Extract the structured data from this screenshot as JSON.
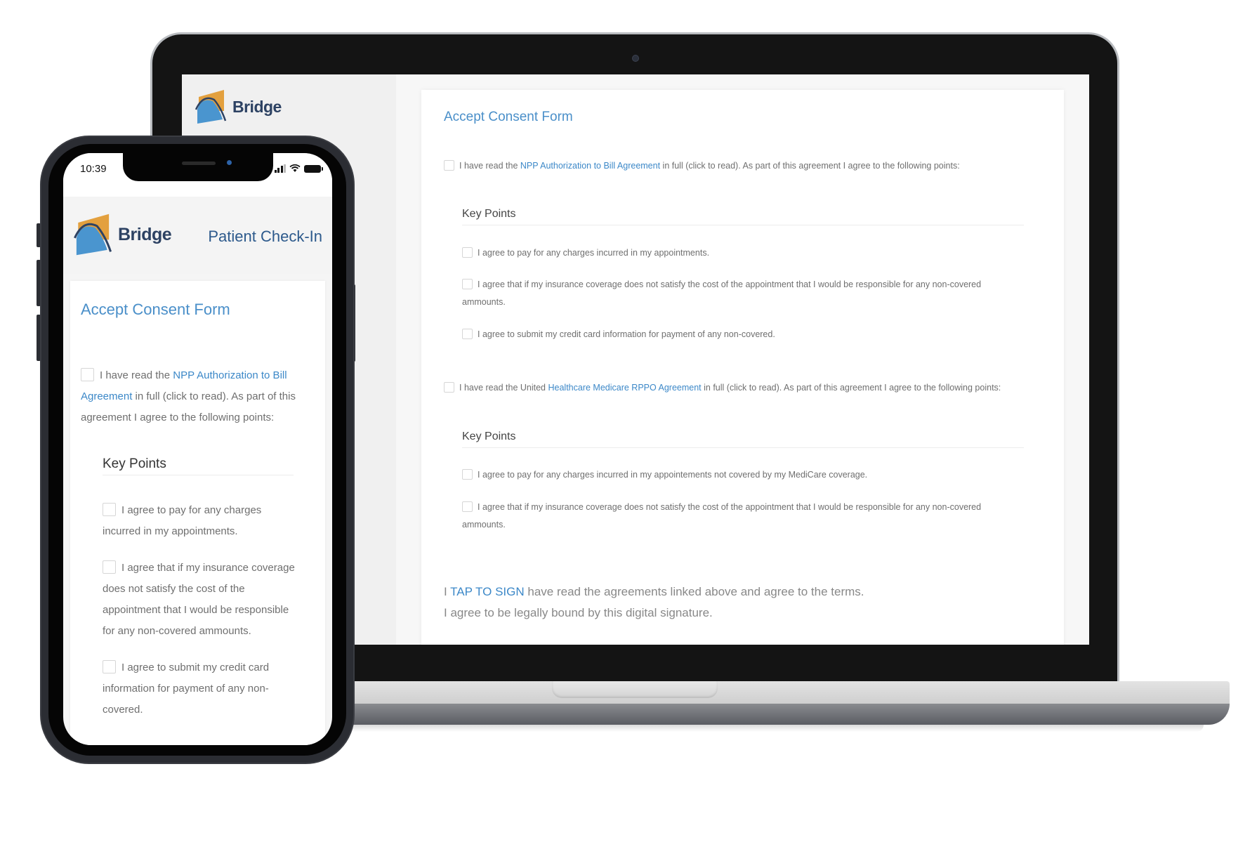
{
  "brand": {
    "name": "Bridge",
    "colors": {
      "accent": "#4a8fc9",
      "link": "#3c88c8",
      "logo_orange": "#e3a03e",
      "logo_blue": "#4a95cf",
      "logo_text": "#2d4263"
    }
  },
  "laptop": {
    "form_title": "Accept Consent Form",
    "agreements": [
      {
        "prefix": "I have read the ",
        "link": "NPP Authorization to Bill Agreement",
        "suffix": " in full (click to read).  As part of this agreement I agree to the following points:",
        "checked": false,
        "key_points_title": "Key Points",
        "points": [
          {
            "text": "I agree to pay for any charges incurred in my appointments.",
            "checked": false
          },
          {
            "text": "I agree that if my insurance coverage does not satisfy the cost of the appointment that I would be responsible for any non-covered",
            "cont": "ammounts.",
            "checked": false
          },
          {
            "text": "I agree to submit my credit card information for payment of any non-covered.",
            "checked": false
          }
        ]
      },
      {
        "prefix": "I have read the United ",
        "link": "Healthcare Medicare RPPO Agreement",
        "suffix": " in full (click to read).  As part of this agreement I agree to the following points:",
        "checked": false,
        "key_points_title": "Key Points",
        "points": [
          {
            "text": "I agree to pay for any charges incurred in my appointements not covered by my MediCare coverage.",
            "checked": false
          },
          {
            "text": "I agree that if my insurance coverage does not satisfy the cost of the appointment that I would be responsible for any non-covered",
            "cont": "ammounts.",
            "checked": false
          }
        ]
      }
    ],
    "signature": {
      "prefix": "I ",
      "link": "TAP TO SIGN",
      "suffix": " have read the agreements linked above and agree to the terms.",
      "line2": "I agree to be legally bound by this digital signature."
    }
  },
  "phone": {
    "status_time": "10:39",
    "header_title": "Patient Check-In",
    "form_title": "Accept Consent Form",
    "agreement": {
      "prefix": "I have read the ",
      "link_line1": "NPP Authorization to Bill",
      "link_line2": "Agreement",
      "suffix_line2": " in full (click to read).  As part of this",
      "line3": "agreement I agree to the following points:"
    },
    "key_points_title": "Key Points",
    "points": [
      {
        "lines": [
          "I agree to pay for any charges",
          "incurred in my appointments."
        ]
      },
      {
        "lines": [
          "I agree that if my insurance coverage",
          "does not satisfy the cost of the",
          "appointment that I would be responsible",
          "for any non-covered ammounts."
        ]
      },
      {
        "lines": [
          "I agree to submit my credit card",
          "information for payment of any non-",
          "covered."
        ]
      }
    ]
  }
}
